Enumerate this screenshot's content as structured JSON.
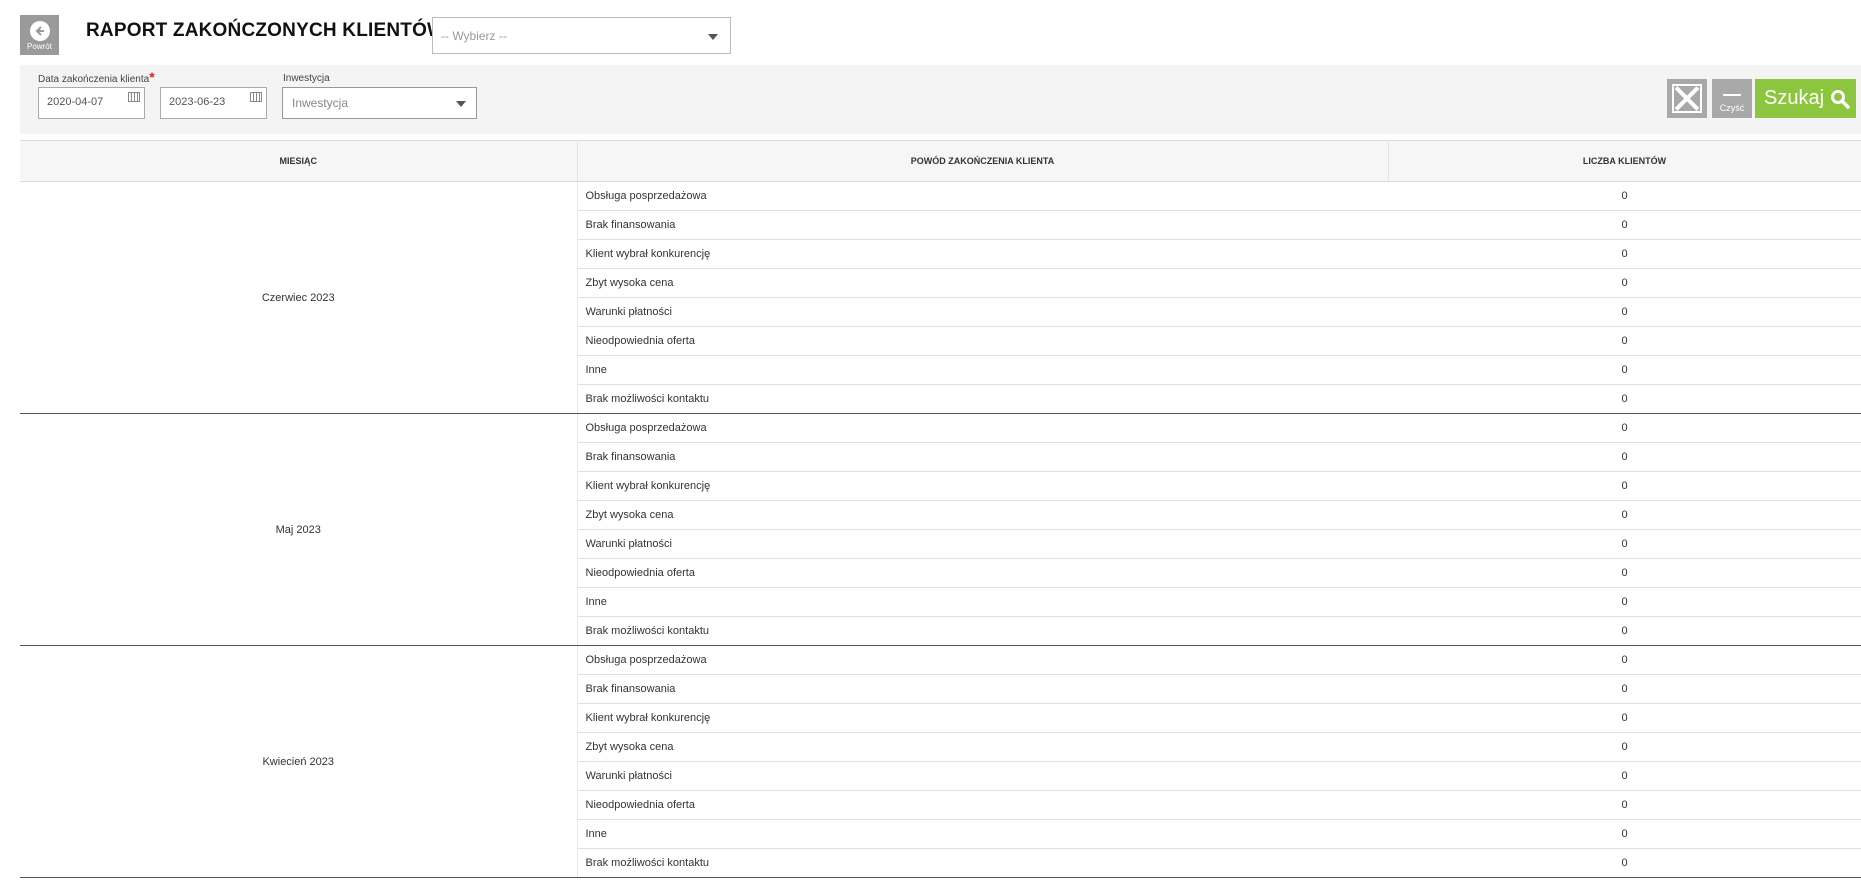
{
  "header": {
    "back_label": "Powrót",
    "title": "RAPORT ZAKOŃCZONYCH KLIENTÓW",
    "select_placeholder": "-- Wybierz --"
  },
  "filters": {
    "date_label": "Data zakończenia klienta",
    "required_mark": "*",
    "date_from": "2020-04-07",
    "date_to": "2023-06-23",
    "investment_label": "Inwestycja",
    "investment_placeholder": "Inwestycja",
    "clear_label": "Czyść",
    "search_label": "Szukaj"
  },
  "table": {
    "headers": [
      "MIESIĄC",
      "POWÓD ZAKOŃCZENIA KLIENTA",
      "LICZBA KLIENTÓW"
    ],
    "groups": [
      {
        "month": "Czerwiec 2023",
        "rows": [
          {
            "reason": "Obsługa posprzedażowa",
            "count": "0"
          },
          {
            "reason": "Brak finansowania",
            "count": "0"
          },
          {
            "reason": "Klient wybrał konkurencję",
            "count": "0"
          },
          {
            "reason": "Zbyt wysoka cena",
            "count": "0"
          },
          {
            "reason": "Warunki płatności",
            "count": "0"
          },
          {
            "reason": "Nieodpowiednia oferta",
            "count": "0"
          },
          {
            "reason": "Inne",
            "count": "0"
          },
          {
            "reason": "Brak możliwości kontaktu",
            "count": "0"
          }
        ]
      },
      {
        "month": "Maj 2023",
        "rows": [
          {
            "reason": "Obsługa posprzedażowa",
            "count": "0"
          },
          {
            "reason": "Brak finansowania",
            "count": "0"
          },
          {
            "reason": "Klient wybrał konkurencję",
            "count": "0"
          },
          {
            "reason": "Zbyt wysoka cena",
            "count": "0"
          },
          {
            "reason": "Warunki płatności",
            "count": "0"
          },
          {
            "reason": "Nieodpowiednia oferta",
            "count": "0"
          },
          {
            "reason": "Inne",
            "count": "0"
          },
          {
            "reason": "Brak możliwości kontaktu",
            "count": "0"
          }
        ]
      },
      {
        "month": "Kwiecień 2023",
        "rows": [
          {
            "reason": "Obsługa posprzedażowa",
            "count": "0"
          },
          {
            "reason": "Brak finansowania",
            "count": "0"
          },
          {
            "reason": "Klient wybrał konkurencję",
            "count": "0"
          },
          {
            "reason": "Zbyt wysoka cena",
            "count": "0"
          },
          {
            "reason": "Warunki płatności",
            "count": "0"
          },
          {
            "reason": "Nieodpowiednia oferta",
            "count": "0"
          },
          {
            "reason": "Inne",
            "count": "0"
          },
          {
            "reason": "Brak możliwości kontaktu",
            "count": "0"
          }
        ]
      }
    ]
  },
  "colors": {
    "accent_green": "#8cc63e",
    "button_gray": "#a8a8a8",
    "required_red": "#e02020"
  },
  "icons": {
    "back": "arrow-left-circle-icon",
    "calendar": "calendar-icon",
    "excel": "excel-export-icon",
    "clear": "dash-icon",
    "search": "magnifier-icon",
    "dropdown": "chevron-down-icon"
  }
}
